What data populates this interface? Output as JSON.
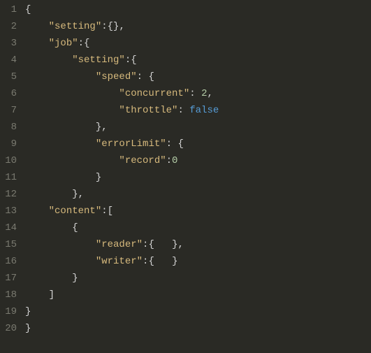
{
  "lines": [
    {
      "num": "1",
      "indent": 0,
      "tokens": [
        [
          "brace",
          "{"
        ]
      ]
    },
    {
      "num": "2",
      "indent": 1,
      "tokens": [
        [
          "string",
          "\"setting\""
        ],
        [
          "colon",
          ":"
        ],
        [
          "brace",
          "{"
        ],
        [
          "brace",
          "}"
        ],
        [
          "punct",
          ","
        ]
      ]
    },
    {
      "num": "3",
      "indent": 1,
      "tokens": [
        [
          "string",
          "\"job\""
        ],
        [
          "colon",
          ":"
        ],
        [
          "brace",
          "{"
        ]
      ]
    },
    {
      "num": "4",
      "indent": 2,
      "tokens": [
        [
          "string",
          "\"setting\""
        ],
        [
          "colon",
          ":"
        ],
        [
          "brace",
          "{"
        ]
      ]
    },
    {
      "num": "5",
      "indent": 3,
      "tokens": [
        [
          "string",
          "\"speed\""
        ],
        [
          "colon",
          ":"
        ],
        [
          "sp",
          " "
        ],
        [
          "brace",
          "{"
        ]
      ]
    },
    {
      "num": "6",
      "indent": 4,
      "tokens": [
        [
          "string",
          "\"concurrent\""
        ],
        [
          "colon",
          ":"
        ],
        [
          "sp",
          " "
        ],
        [
          "number",
          "2"
        ],
        [
          "punct",
          ","
        ]
      ]
    },
    {
      "num": "7",
      "indent": 4,
      "tokens": [
        [
          "string",
          "\"throttle\""
        ],
        [
          "colon",
          ":"
        ],
        [
          "sp",
          " "
        ],
        [
          "bool",
          "false"
        ]
      ]
    },
    {
      "num": "8",
      "indent": 3,
      "tokens": [
        [
          "brace",
          "}"
        ],
        [
          "punct",
          ","
        ]
      ]
    },
    {
      "num": "9",
      "indent": 3,
      "tokens": [
        [
          "string",
          "\"errorLimit\""
        ],
        [
          "colon",
          ":"
        ],
        [
          "sp",
          " "
        ],
        [
          "brace",
          "{"
        ]
      ]
    },
    {
      "num": "10",
      "indent": 4,
      "tokens": [
        [
          "string",
          "\"record\""
        ],
        [
          "colon",
          ":"
        ],
        [
          "number",
          "0"
        ]
      ]
    },
    {
      "num": "11",
      "indent": 3,
      "tokens": [
        [
          "brace",
          "}"
        ]
      ]
    },
    {
      "num": "12",
      "indent": 2,
      "tokens": [
        [
          "brace",
          "}"
        ],
        [
          "punct",
          ","
        ]
      ]
    },
    {
      "num": "13",
      "indent": 1,
      "tokens": [
        [
          "string",
          "\"content\""
        ],
        [
          "colon",
          ":"
        ],
        [
          "punct",
          "["
        ]
      ]
    },
    {
      "num": "14",
      "indent": 2,
      "tokens": [
        [
          "brace",
          "{"
        ]
      ]
    },
    {
      "num": "15",
      "indent": 3,
      "tokens": [
        [
          "string",
          "\"reader\""
        ],
        [
          "colon",
          ":"
        ],
        [
          "brace",
          "{"
        ],
        [
          "sp",
          "   "
        ],
        [
          "brace",
          "}"
        ],
        [
          "punct",
          ","
        ]
      ]
    },
    {
      "num": "16",
      "indent": 3,
      "tokens": [
        [
          "string",
          "\"writer\""
        ],
        [
          "colon",
          ":"
        ],
        [
          "brace",
          "{"
        ],
        [
          "sp",
          "   "
        ],
        [
          "brace",
          "}"
        ]
      ]
    },
    {
      "num": "17",
      "indent": 2,
      "tokens": [
        [
          "brace",
          "}"
        ]
      ]
    },
    {
      "num": "18",
      "indent": 1,
      "tokens": [
        [
          "punct",
          "]"
        ]
      ]
    },
    {
      "num": "19",
      "indent": 0,
      "tokens": [
        [
          "brace",
          "}"
        ]
      ]
    },
    {
      "num": "20",
      "indent": 0,
      "tokens": [
        [
          "brace",
          "}"
        ]
      ]
    }
  ],
  "indent_unit": "    "
}
